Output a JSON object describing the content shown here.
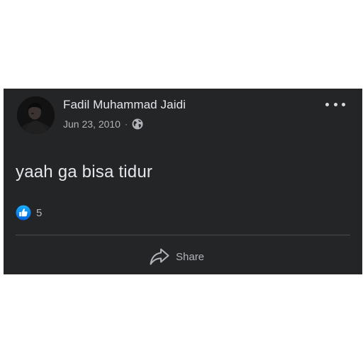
{
  "post": {
    "author_name": "Fadil Muhammad Jaidi",
    "date": "Jun 23, 2010",
    "separator": "·",
    "audience_icon": "globe-icon",
    "more_icon": "more-options-icon",
    "text": "yaah ga bisa tidur",
    "reactions": {
      "icon": "like-icon",
      "count": "5"
    },
    "actions": {
      "share_label": "Share",
      "share_icon": "share-icon"
    }
  },
  "colors": {
    "card_background": "#242526",
    "primary_text": "#e4e6eb",
    "secondary_text": "#b0b3b8",
    "like_blue": "#1877f2"
  }
}
